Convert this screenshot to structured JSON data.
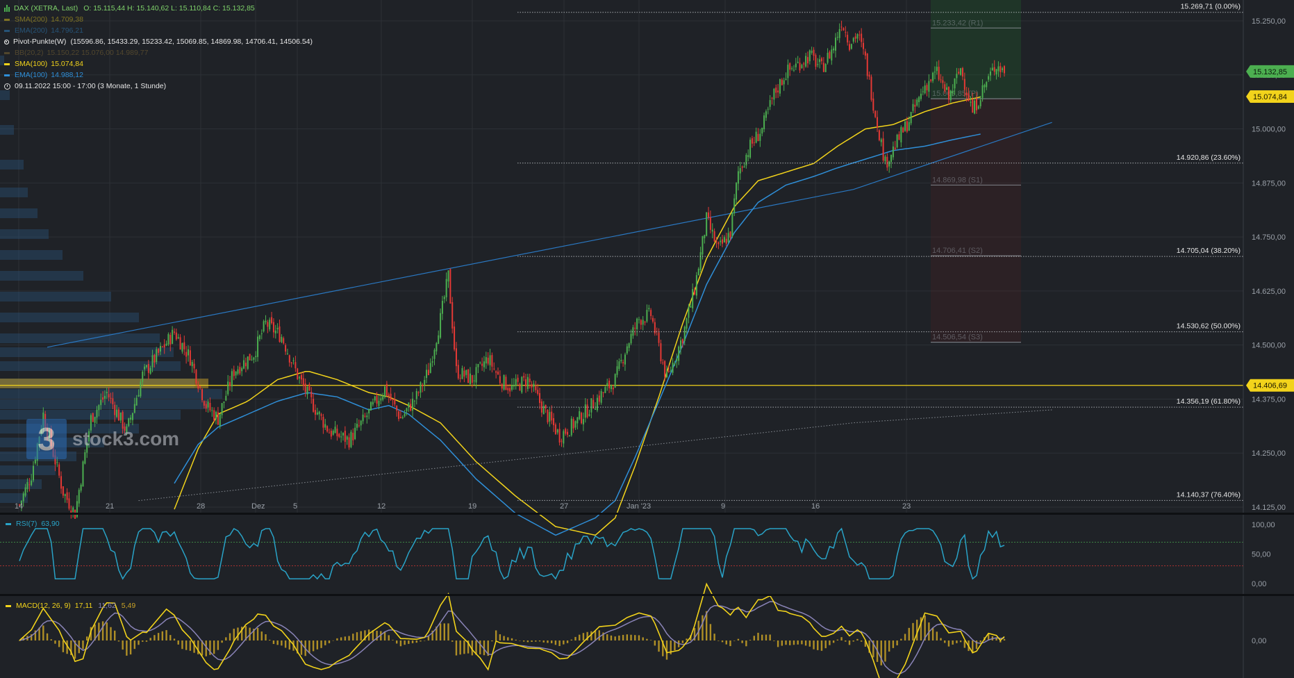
{
  "legend": {
    "instrument": "DAX (XETRA, Last)",
    "ohlc": "O: 15.115,44  H: 15.140,62  L: 15.110,84  C: 15.132,85",
    "sma200_label": "SMA(200)",
    "sma200_value": "14.709,38",
    "ema200_label": "EMA(200)",
    "ema200_value": "14.796,21",
    "pivot_label": "Pivot-Punkte(W)",
    "pivot_values": "(15596.86, 15433.29, 15233.42, 15069.85, 14869.98, 14706.41, 14506.54)",
    "bb_label": "BB(20,2)",
    "bb_value": "15.150,22  15.076,00  14.989,77",
    "sma100_label": "SMA(100)",
    "sma100_value": "15.074,84",
    "ema100_label": "EMA(100)",
    "ema100_value": "14.988,12",
    "period": "09.11.2022 15:00 - 17:00   (3 Monate, 1 Stunde)"
  },
  "logo": {
    "mark": "3",
    "text": "stock3.com"
  },
  "colors": {
    "background": "#1f2227",
    "grid": "#2c3036",
    "up": "#4caf50",
    "down": "#e53935",
    "sma": "#f2d31b",
    "ema": "#2f8fd8",
    "price_badge": "#4caf50",
    "sma_badge": "#f2d31b",
    "volume_profile": "#2b5f93",
    "rsi": "#29a3c7",
    "macd": "#f2d31b",
    "signal": "#8a84b8"
  },
  "chart_data": {
    "type": "candlestick",
    "y_ticks": [
      "15.250,00",
      "15.125,00",
      "15.000,00",
      "14.875,00",
      "14.750,00",
      "14.625,00",
      "14.500,00",
      "14.375,00",
      "14.250,00",
      "14.125,00"
    ],
    "x_ticks": [
      "14",
      "21",
      "28",
      "Dez",
      "5",
      "12",
      "19",
      "27",
      "Jan '23",
      "9",
      "16",
      "23"
    ],
    "fibonacci": [
      {
        "value": 15269.71,
        "label": "15.269,71 (0.00%)"
      },
      {
        "value": 14920.86,
        "label": "14.920,86 (23.60%)"
      },
      {
        "value": 14705.04,
        "label": "14.705,04 (38.20%)"
      },
      {
        "value": 14530.62,
        "label": "14.530,62 (50.00%)"
      },
      {
        "value": 14356.19,
        "label": "14.356,19 (61.80%)"
      },
      {
        "value": 14140.37,
        "label": "14.140,37 (76.40%)"
      }
    ],
    "pivots": [
      {
        "value": 15233.42,
        "label": "15.233,42 (R1)"
      },
      {
        "value": 15069.85,
        "label": "15.069,85 (P)"
      },
      {
        "value": 14869.98,
        "label": "14.869,98 (S1)"
      },
      {
        "value": 14706.41,
        "label": "14.706,41 (S2)"
      },
      {
        "value": 14506.54,
        "label": "14.506,54 (S3)"
      }
    ],
    "hline": {
      "value": 14406.69,
      "label": "14.406,69"
    },
    "price_badge": {
      "value": 15132.85,
      "label": "15.132,85"
    },
    "sma_badge": {
      "value": 15074.84,
      "label": "15.074,84"
    },
    "path_points": [
      [
        0,
        14130
      ],
      [
        6,
        14200
      ],
      [
        12,
        14340
      ],
      [
        22,
        14160
      ],
      [
        28,
        14110
      ],
      [
        36,
        14330
      ],
      [
        44,
        14390
      ],
      [
        54,
        14300
      ],
      [
        62,
        14430
      ],
      [
        70,
        14480
      ],
      [
        78,
        14530
      ],
      [
        86,
        14470
      ],
      [
        94,
        14360
      ],
      [
        100,
        14330
      ],
      [
        108,
        14440
      ],
      [
        118,
        14480
      ],
      [
        124,
        14550
      ],
      [
        132,
        14520
      ],
      [
        140,
        14430
      ],
      [
        148,
        14360
      ],
      [
        156,
        14300
      ],
      [
        166,
        14280
      ],
      [
        174,
        14330
      ],
      [
        184,
        14400
      ],
      [
        192,
        14330
      ],
      [
        200,
        14380
      ],
      [
        206,
        14440
      ],
      [
        212,
        14560
      ],
      [
        216,
        14660
      ],
      [
        220,
        14440
      ],
      [
        228,
        14420
      ],
      [
        236,
        14470
      ],
      [
        242,
        14420
      ],
      [
        248,
        14400
      ],
      [
        256,
        14420
      ],
      [
        264,
        14350
      ],
      [
        272,
        14290
      ],
      [
        280,
        14320
      ],
      [
        288,
        14360
      ],
      [
        300,
        14420
      ],
      [
        306,
        14500
      ],
      [
        312,
        14560
      ],
      [
        318,
        14570
      ],
      [
        326,
        14420
      ],
      [
        334,
        14520
      ],
      [
        340,
        14630
      ],
      [
        346,
        14790
      ],
      [
        352,
        14720
      ],
      [
        358,
        14760
      ],
      [
        362,
        14900
      ],
      [
        368,
        14960
      ],
      [
        374,
        15000
      ],
      [
        380,
        15080
      ],
      [
        386,
        15130
      ],
      [
        392,
        15150
      ],
      [
        398,
        15170
      ],
      [
        404,
        15140
      ],
      [
        410,
        15190
      ],
      [
        414,
        15250
      ],
      [
        418,
        15200
      ],
      [
        422,
        15220
      ],
      [
        426,
        15160
      ],
      [
        430,
        15060
      ],
      [
        436,
        14920
      ],
      [
        442,
        14970
      ],
      [
        448,
        15020
      ],
      [
        456,
        15100
      ],
      [
        462,
        15130
      ],
      [
        468,
        15070
      ],
      [
        474,
        15140
      ],
      [
        480,
        15040
      ],
      [
        486,
        15100
      ],
      [
        492,
        15150
      ],
      [
        496,
        15132
      ]
    ],
    "path_point_count": 497,
    "sma_points": [
      [
        78,
        14120
      ],
      [
        90,
        14260
      ],
      [
        100,
        14340
      ],
      [
        115,
        14370
      ],
      [
        130,
        14420
      ],
      [
        145,
        14440
      ],
      [
        160,
        14420
      ],
      [
        176,
        14390
      ],
      [
        186,
        14380
      ],
      [
        196,
        14360
      ],
      [
        212,
        14320
      ],
      [
        230,
        14230
      ],
      [
        250,
        14150
      ],
      [
        270,
        14080
      ],
      [
        290,
        14060
      ],
      [
        300,
        14100
      ],
      [
        310,
        14220
      ],
      [
        322,
        14380
      ],
      [
        334,
        14550
      ],
      [
        346,
        14700
      ],
      [
        360,
        14820
      ],
      [
        372,
        14880
      ],
      [
        386,
        14900
      ],
      [
        400,
        14920
      ],
      [
        412,
        14960
      ],
      [
        426,
        15000
      ],
      [
        440,
        15010
      ],
      [
        456,
        15040
      ],
      [
        470,
        15060
      ],
      [
        484,
        15074
      ]
    ],
    "ema_points": [
      [
        78,
        14180
      ],
      [
        90,
        14270
      ],
      [
        100,
        14310
      ],
      [
        115,
        14340
      ],
      [
        130,
        14370
      ],
      [
        145,
        14390
      ],
      [
        160,
        14380
      ],
      [
        176,
        14350
      ],
      [
        186,
        14360
      ],
      [
        196,
        14340
      ],
      [
        212,
        14280
      ],
      [
        230,
        14190
      ],
      [
        250,
        14110
      ],
      [
        270,
        14060
      ],
      [
        290,
        14100
      ],
      [
        300,
        14140
      ],
      [
        310,
        14240
      ],
      [
        322,
        14370
      ],
      [
        334,
        14500
      ],
      [
        346,
        14640
      ],
      [
        360,
        14760
      ],
      [
        372,
        14830
      ],
      [
        386,
        14870
      ],
      [
        400,
        14890
      ],
      [
        412,
        14910
      ],
      [
        426,
        14930
      ],
      [
        440,
        14950
      ],
      [
        456,
        14960
      ],
      [
        470,
        14975
      ],
      [
        484,
        14988
      ]
    ],
    "trendline_points": [
      [
        14,
        14495
      ],
      [
        420,
        14860
      ],
      [
        520,
        15015
      ]
    ],
    "support_points": [
      [
        60,
        14140
      ],
      [
        420,
        14320
      ],
      [
        520,
        14350
      ]
    ],
    "rsi": {
      "label": "RSI(7)",
      "value": "63,90",
      "ticks": [
        "100,00",
        "50,00",
        "0,00"
      ],
      "upper": 70,
      "lower": 30
    },
    "macd": {
      "label": "MACD(12, 26, 9)",
      "value": "17,11",
      "signal": "11,62",
      "hist": "5,49",
      "tick": "0,00"
    }
  }
}
